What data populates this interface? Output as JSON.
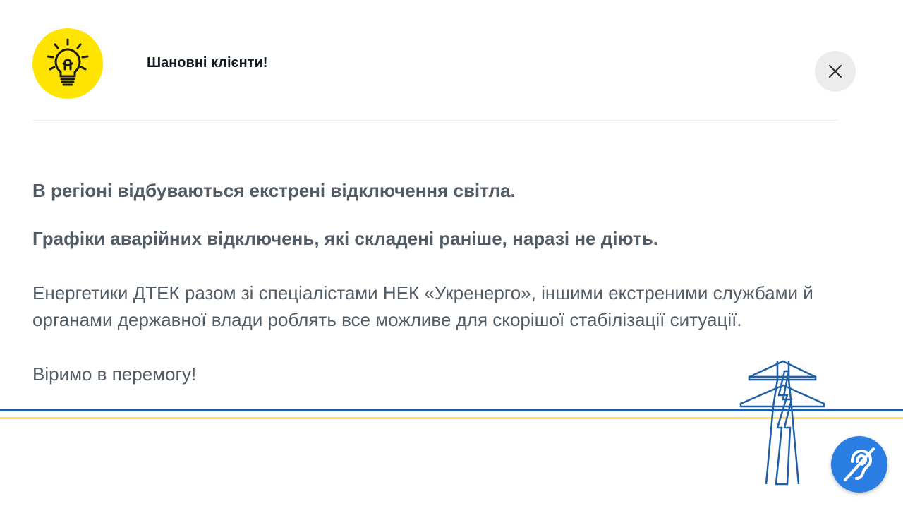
{
  "header": {
    "title": "Шановні клієнти!",
    "badge_icon": "lightbulb-icon",
    "badge_color": "#ffe400"
  },
  "close_button": {
    "icon": "close-icon"
  },
  "message": {
    "line1": "В регіоні відбуваються екстрені відключення світла.",
    "line2": "Графіки аварійних відключень, які складені раніше, наразі не діють.",
    "paragraph": "Енергетики ДТЕК разом зі спеціалістами НЕК «Укренерго», іншими екстреними службами й органами державної влади роблять все можливе для скорішої стабілізації ситуації.",
    "closing": "Віримо в перемогу!"
  },
  "decoration": {
    "stripe_blue": "#1f5fa8",
    "stripe_yellow": "#ffe14d",
    "pylon_icon": "power-pylon-icon"
  },
  "accessibility_button": {
    "icon": "hearing-impaired-icon",
    "color": "#2a7de1"
  }
}
